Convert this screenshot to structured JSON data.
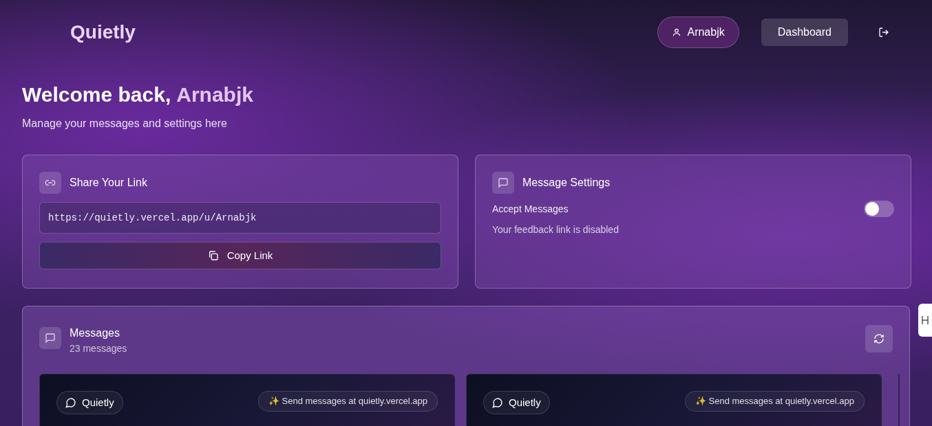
{
  "header": {
    "logo": "Quietly",
    "user_button": "Arnabjk",
    "nav_button": "Dashboard"
  },
  "welcome": {
    "greeting": "Welcome back,",
    "name": "Arnabjk",
    "subtitle": "Manage your messages and settings here"
  },
  "share_card": {
    "title": "Share Your Link",
    "link": "https://quietly.vercel.app/u/Arnabjk",
    "button": "Copy Link"
  },
  "settings_card": {
    "title": "Message Settings",
    "toggle": {
      "label": "Accept Messages",
      "on": false
    },
    "status": "Your feedback link is disabled"
  },
  "messages_card": {
    "title": "Messages",
    "count": "23 messages",
    "messages": [
      {
        "badge": "Quietly",
        "promo": "✨ Send messages at quietly.vercel.app"
      },
      {
        "badge": "Quietly",
        "promo": "✨ Send messages at quietly.vercel.app"
      }
    ]
  }
}
